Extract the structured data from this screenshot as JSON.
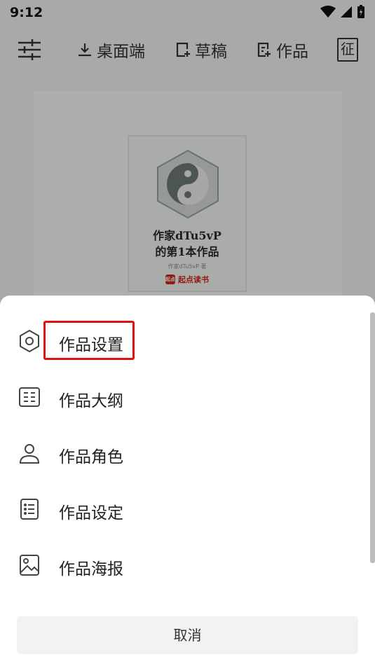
{
  "status_bar": {
    "time": "9:12"
  },
  "toolbar": {
    "items": [
      {
        "label": "桌面端",
        "icon": "download-icon"
      },
      {
        "label": "草稿",
        "icon": "draft-add-icon"
      },
      {
        "label": "作品",
        "icon": "works-add-icon"
      }
    ],
    "stamp_label": "征"
  },
  "cover": {
    "title_line1": "作家dTu5vP",
    "title_line2": "的第1本作品",
    "author": "作家dTu5vP 著",
    "publisher": "起点读书",
    "publisher_badge": "起点"
  },
  "menu": {
    "items": [
      {
        "label": "作品设置",
        "icon": "hexagon-settings-icon"
      },
      {
        "label": "作品大纲",
        "icon": "outline-icon"
      },
      {
        "label": "作品角色",
        "icon": "person-icon"
      },
      {
        "label": "作品设定",
        "icon": "list-document-icon"
      },
      {
        "label": "作品海报",
        "icon": "image-icon"
      }
    ],
    "cancel_label": "取消"
  },
  "colors": {
    "highlight": "#e01010",
    "publisher_red": "#d0261f"
  }
}
